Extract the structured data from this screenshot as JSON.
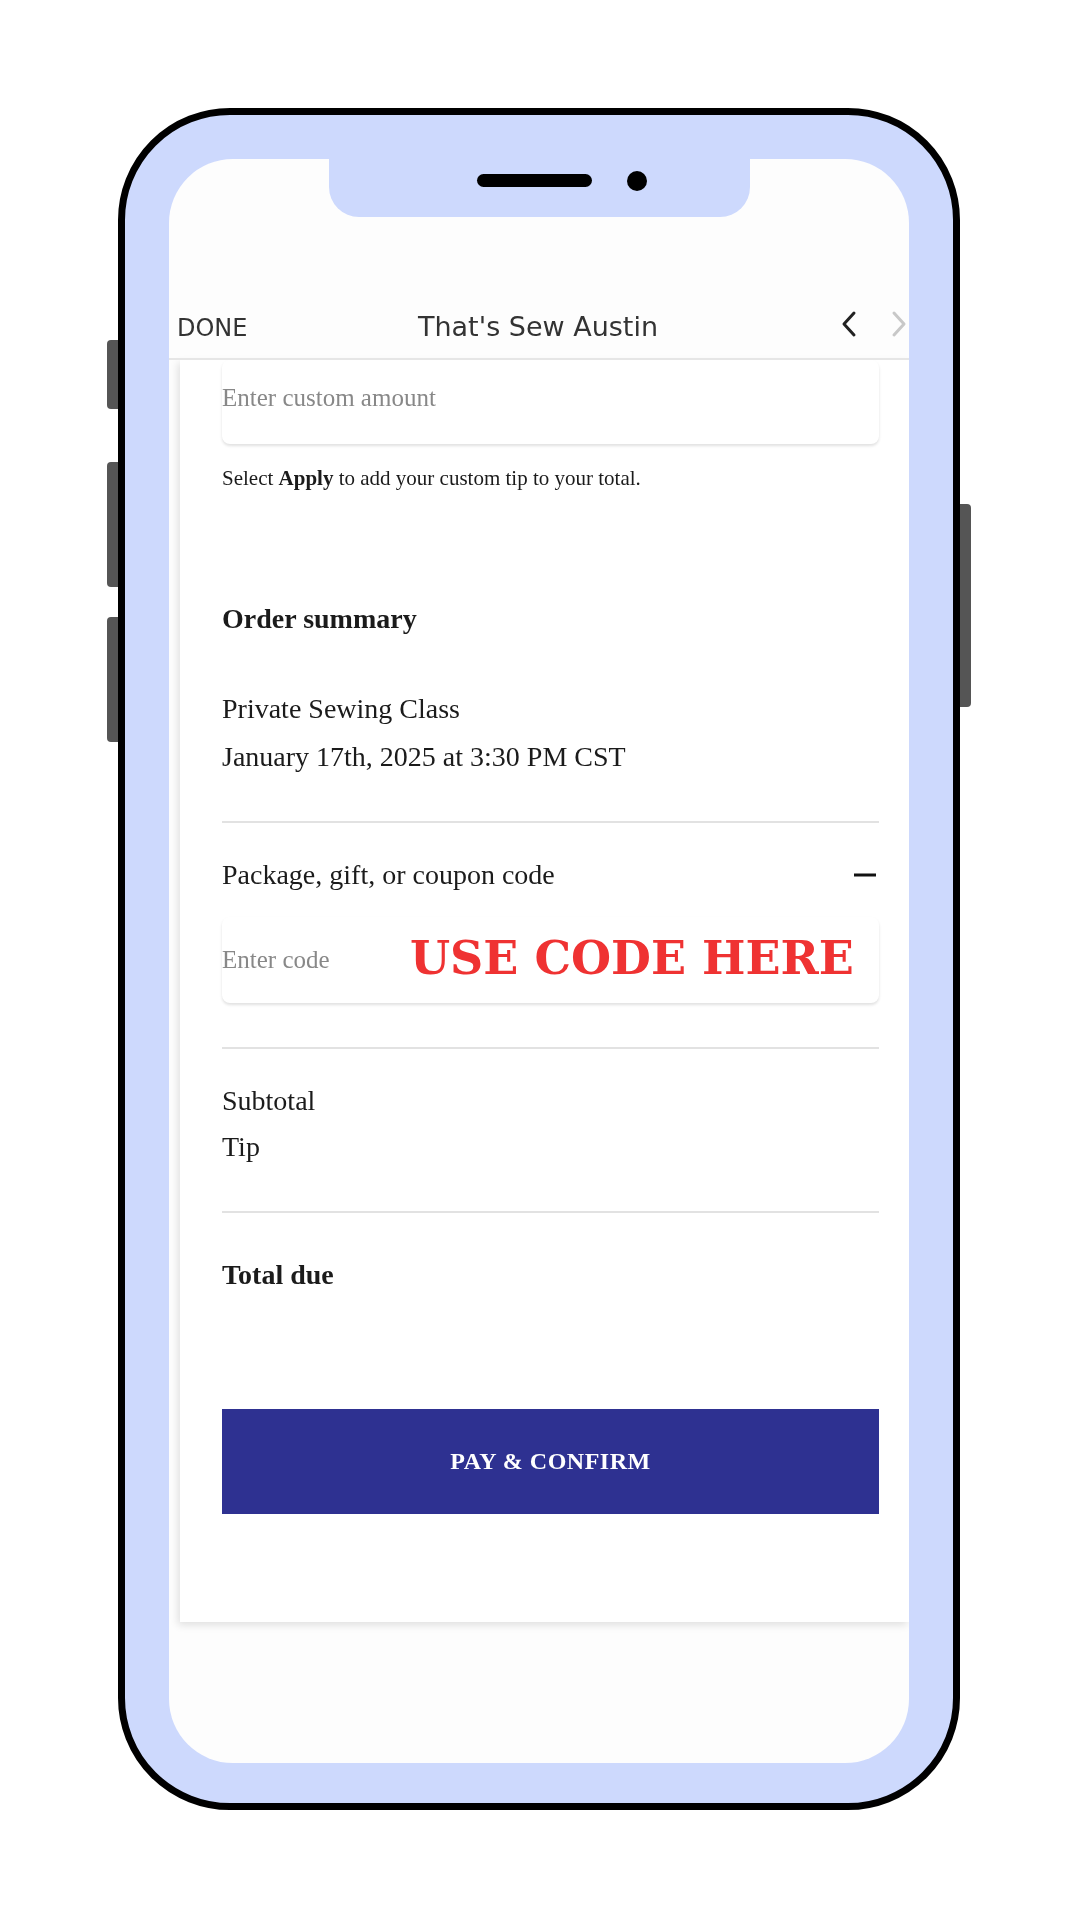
{
  "header": {
    "done": "DONE",
    "title": "That's Sew Austin",
    "nav": [
      {
        "kind": "back",
        "disabled": false
      },
      {
        "kind": "forward",
        "disabled": true
      }
    ]
  },
  "tip": {
    "placeholder": "Enter custom amount",
    "hint": "Select **Apply** to add your custom tip to your total."
  },
  "order_summary": {
    "heading": "Order summary",
    "item": "Private Sewing Class",
    "date": "January 17th, 2025 at 3:30 PM CST"
  },
  "coupon": {
    "label": "Package, gift, or coupon code",
    "expanded": true,
    "placeholder": "Enter code",
    "overlay": "USE CODE HERE"
  },
  "totals": {
    "lines": [
      "Subtotal",
      "Tip"
    ],
    "total": "Total due"
  },
  "button": "PAY & CONFIRM"
}
